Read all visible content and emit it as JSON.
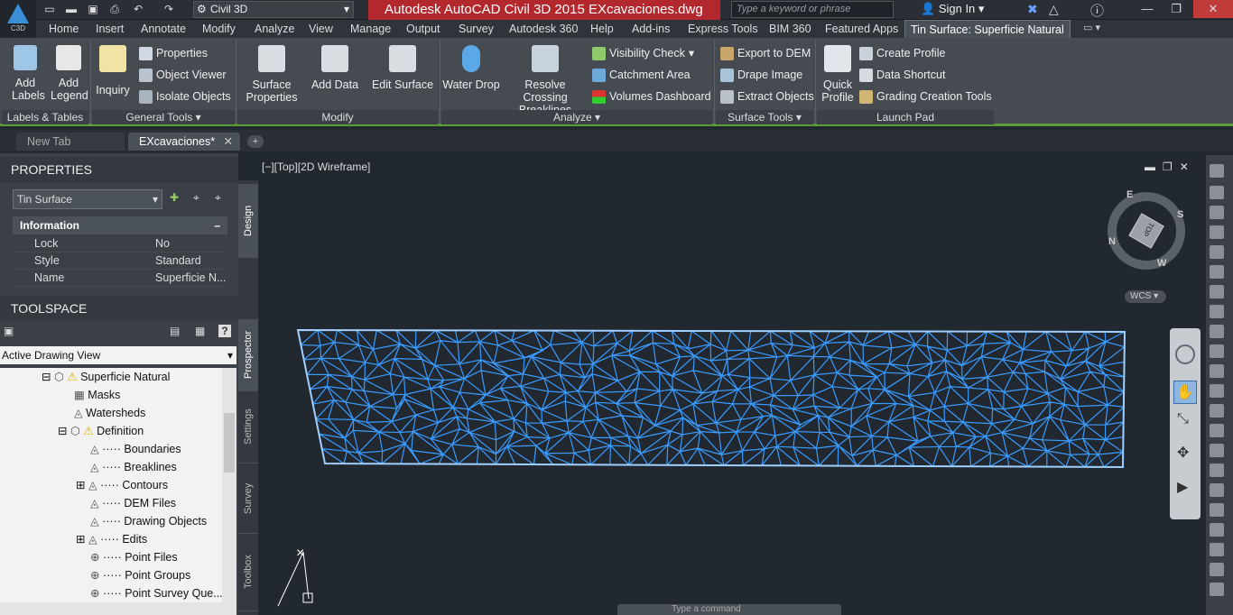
{
  "app": {
    "logo": "C3D",
    "title": "Autodesk AutoCAD Civil 3D 2015    EXcavaciones.dwg",
    "workspace": "Civil 3D",
    "search_placeholder": "Type a keyword or phrase",
    "sign_in": "Sign In"
  },
  "ribbon_tabs": [
    "Home",
    "Insert",
    "Annotate",
    "Modify",
    "Analyze",
    "View",
    "Manage",
    "Output",
    "Survey",
    "Autodesk 360",
    "Help",
    "Add-ins",
    "Express Tools",
    "BIM 360",
    "Featured Apps",
    "Tin Surface: Superficie Natural"
  ],
  "panels": {
    "labels": {
      "title": "Labels & Tables",
      "add_labels": "Add Labels",
      "add_legend": "Add Legend"
    },
    "general": {
      "title": "General Tools",
      "inquiry": "Inquiry",
      "properties": "Properties",
      "object_viewer": "Object Viewer",
      "isolate": "Isolate Objects"
    },
    "modify": {
      "title": "Modify",
      "surface_props": "Surface Properties",
      "add_data": "Add Data",
      "edit_surface": "Edit Surface"
    },
    "analyze": {
      "title": "Analyze",
      "water_drop": "Water Drop",
      "resolve": "Resolve Crossing Breaklines",
      "visibility": "Visibility Check",
      "catchment": "Catchment Area",
      "volumes": "Volumes Dashboard"
    },
    "surface_tools": {
      "title": "Surface Tools",
      "export_dem": "Export to DEM",
      "drape": "Drape Image",
      "extract": "Extract Objects"
    },
    "launch": {
      "title": "Launch Pad",
      "quick_profile": "Quick Profile",
      "create_profile": "Create Profile",
      "data_shortcut": "Data Shortcut",
      "grading": "Grading Creation Tools"
    }
  },
  "doc_tabs": [
    "New Tab",
    "EXcavaciones*"
  ],
  "properties": {
    "header": "PROPERTIES",
    "object_type": "Tin Surface",
    "section": "Information",
    "rows": [
      [
        "Lock",
        "No"
      ],
      [
        "Style",
        "Standard"
      ],
      [
        "Name",
        "Superficie N..."
      ]
    ]
  },
  "toolspace": {
    "header": "TOOLSPACE",
    "view": "Active Drawing View",
    "items": [
      "Superficie Natural",
      "Masks",
      "Watersheds",
      "Definition",
      "Boundaries",
      "Breaklines",
      "Contours",
      "DEM Files",
      "Drawing Objects",
      "Edits",
      "Point Files",
      "Point Groups",
      "Point Survey Que..."
    ]
  },
  "vtabs": [
    "Design",
    "Prospector",
    "Settings",
    "Survey",
    "Toolbox"
  ],
  "viewport": {
    "label": "[−][Top][2D Wireframe]",
    "wcs": "WCS",
    "cube_top": "TOP",
    "compass": [
      "N",
      "E",
      "S",
      "W"
    ]
  },
  "command": {
    "placeholder": "Type a command"
  },
  "colors": {
    "mesh": "#3a9bff",
    "accent": "#b3282d",
    "ribbon_active": "#5d9c3a"
  }
}
